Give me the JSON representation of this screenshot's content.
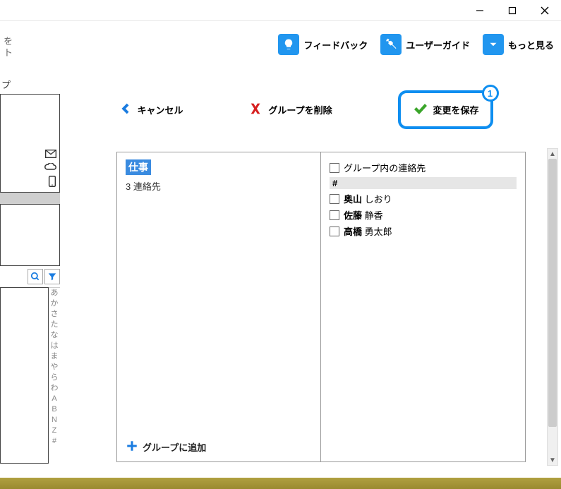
{
  "header": {
    "feedback": "フィードバック",
    "userguide": "ユーザーガイド",
    "more": "もっと見る"
  },
  "actions": {
    "cancel": "キャンセル",
    "delete": "グループを削除",
    "save": "変更を保存",
    "badge": "1"
  },
  "left_fragment": {
    "title_fragment1": "を",
    "title_fragment2": "ト",
    "tab_fragment": "プ",
    "alpha_index": "あかさたなはまやらわABNZ#"
  },
  "group": {
    "name": "仕事",
    "count": "3 連絡先",
    "add": "グループに追加"
  },
  "right": {
    "header_checkbox_label": "グループ内の連絡先",
    "section": "#",
    "contacts": [
      {
        "surname": "奥山",
        "given": "しおり"
      },
      {
        "surname": "佐藤",
        "given": "静香"
      },
      {
        "surname": "高橋",
        "given": "勇太郎"
      }
    ]
  }
}
